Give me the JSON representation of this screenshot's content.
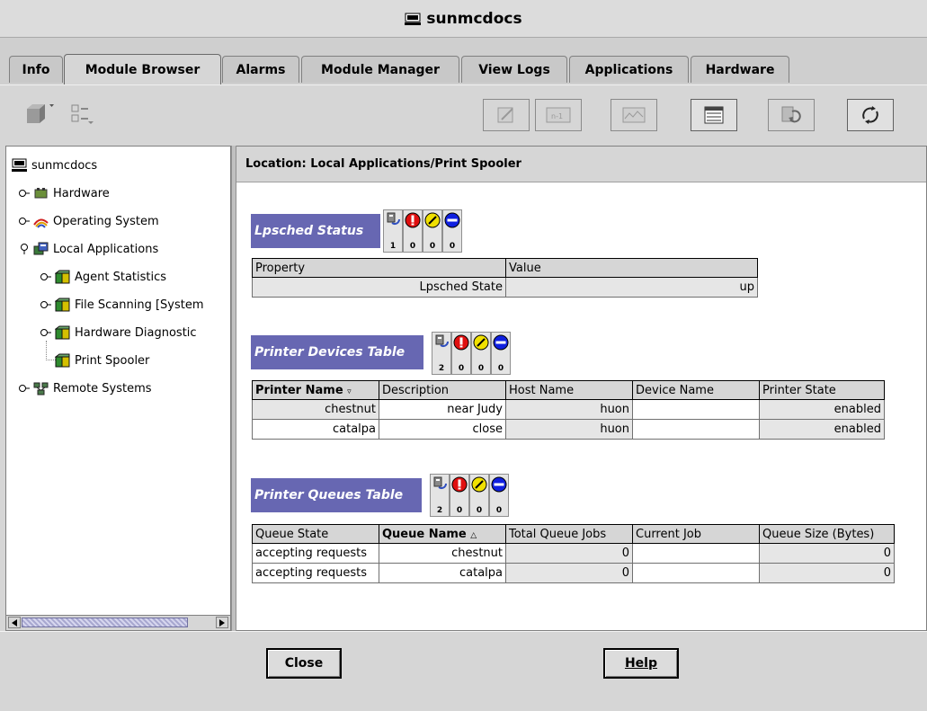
{
  "window": {
    "title": "sunmcdocs"
  },
  "tabs": [
    {
      "label": "Info"
    },
    {
      "label": "Module Browser"
    },
    {
      "label": "Alarms"
    },
    {
      "label": "Module Manager"
    },
    {
      "label": "View Logs"
    },
    {
      "label": "Applications"
    },
    {
      "label": "Hardware"
    }
  ],
  "toolbar": {
    "right_buttons": [
      {
        "icon": "edit-icon"
      },
      {
        "icon": "n-1-icon",
        "label": "n-1"
      },
      {
        "icon": "graph-icon"
      },
      {
        "icon": "table-view-icon"
      },
      {
        "icon": "refresh-icon"
      },
      {
        "icon": "probe-icon"
      }
    ]
  },
  "tree": {
    "root": "sunmcdocs",
    "items": [
      {
        "label": "Hardware"
      },
      {
        "label": "Operating System"
      },
      {
        "label": "Local Applications"
      },
      {
        "label": "Agent Statistics"
      },
      {
        "label": "File Scanning [System"
      },
      {
        "label": "Hardware Diagnostic"
      },
      {
        "label": "Print Spooler"
      },
      {
        "label": "Remote Systems"
      }
    ]
  },
  "location": {
    "text": "Location:  Local Applications/Print Spooler"
  },
  "lpsched": {
    "title": "Lpsched Status",
    "counts": [
      "1",
      "0",
      "0",
      "0"
    ],
    "headers": [
      "Property",
      "Value"
    ],
    "rows": [
      [
        "Lpsched State",
        "up"
      ]
    ]
  },
  "devices": {
    "title": "Printer Devices Table",
    "counts": [
      "2",
      "0",
      "0",
      "0"
    ],
    "headers": [
      "Printer Name",
      "Description",
      "Host Name",
      "Device Name",
      "Printer State"
    ],
    "rows": [
      [
        "chestnut",
        "near Judy",
        "huon",
        "",
        "enabled"
      ],
      [
        "catalpa",
        "close",
        "huon",
        "",
        "enabled"
      ]
    ]
  },
  "queues": {
    "title": "Printer Queues Table",
    "counts": [
      "2",
      "0",
      "0",
      "0"
    ],
    "headers": [
      "Queue State",
      "Queue Name",
      "Total Queue Jobs",
      "Current Job",
      "Queue Size (Bytes)"
    ],
    "rows": [
      [
        "accepting requests",
        "chestnut",
        "0",
        "",
        "0"
      ],
      [
        "accepting requests",
        "catalpa",
        "0",
        "",
        "0"
      ]
    ]
  },
  "buttons": {
    "close": "Close",
    "help": "Help"
  },
  "colors": {
    "section_header": "#6767b2",
    "alarm_red": "#e01010",
    "alarm_yellow": "#f0e000",
    "alarm_blue": "#1020e0"
  }
}
